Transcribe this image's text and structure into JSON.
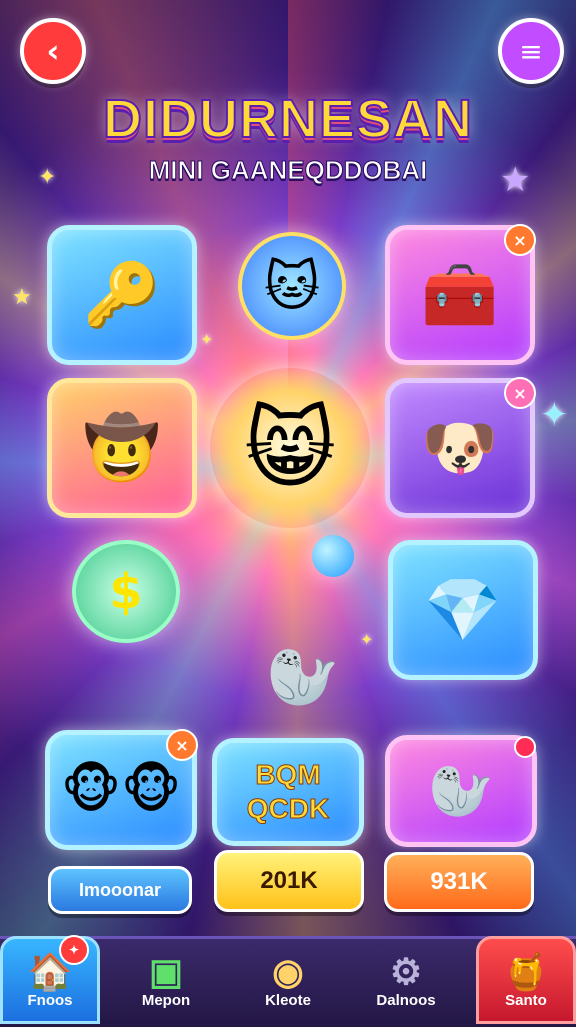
{
  "header": {
    "back_icon": "chevron-left-icon",
    "menu_icon": "hamburger-menu-icon",
    "title": "DIDURNESAN",
    "subtitle": "MINI GAANEQDDOBAI"
  },
  "tiles": {
    "top_left_icon": "golden-key-icon",
    "top_center_icon": "cat-face-icon",
    "top_right_icon": "treasure-table-icon",
    "mid_left_icon": "hat-smiley-icon",
    "center_icon": "cat-musician-icon",
    "mid_right_icon": "dog-with-gun-icon",
    "lower_left_icon": "dollar-orb-icon",
    "lower_right_icon": "crystal-gem-icon",
    "lower_center_icon": "seal-pillow-icon",
    "bottom_left_icon": "two-monkeys-icon",
    "bottom_center_letters": "BQMQCDK",
    "bottom_center_letters_line1": "BQM",
    "bottom_center_letters_line2": "QCDK",
    "bottom_right_icon": "seal-capsule-icon"
  },
  "buttons": {
    "left_label": "Imooonar",
    "center_label": "201K",
    "right_label": "931K"
  },
  "bottom_nav": [
    {
      "label": "Fnoos",
      "icon": "home-icon"
    },
    {
      "label": "Mepon",
      "icon": "square-icon"
    },
    {
      "label": "Kleote",
      "icon": "record-icon"
    },
    {
      "label": "Dalnoos",
      "icon": "gear-icon"
    },
    {
      "label": "Santo",
      "icon": "pot-icon"
    }
  ],
  "colors": {
    "accent_yellow": "#ffd93a",
    "accent_blue": "#2a8bff",
    "accent_red": "#ff4d4d",
    "accent_purple": "#7a3cc8"
  }
}
